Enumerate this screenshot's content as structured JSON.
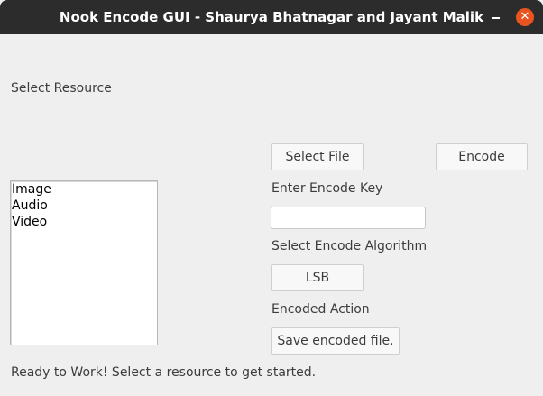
{
  "window": {
    "title": "Nook Encode GUI - Shaurya Bhatnagar and Jayant Malik",
    "close_glyph": "✕"
  },
  "resource": {
    "label": "Select Resource",
    "items": [
      "Image",
      "Audio",
      "Video"
    ]
  },
  "buttons": {
    "select_file": "Select File",
    "encode": "Encode",
    "algorithm": "LSB",
    "save": "Save encoded file."
  },
  "key": {
    "label": "Enter Encode Key",
    "value": ""
  },
  "algorithm_label": "Select Encode Algorithm",
  "action_label": "Encoded Action",
  "status": "Ready to Work! Select a resource to get started.",
  "colors": {
    "titlebar": "#2c2c2c",
    "close_button": "#e95420",
    "background": "#efefef"
  }
}
